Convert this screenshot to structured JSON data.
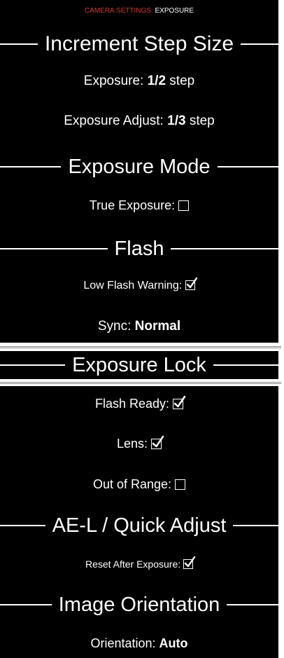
{
  "breadcrumb": {
    "section": "CAMERA SETTINGS:",
    "page": "EXPOSURE"
  },
  "colors": {
    "background": "#000000",
    "accent": "#d23a2e",
    "text": "#ffffff"
  },
  "sections": {
    "increment": {
      "title": "Increment Step Size",
      "exposure": {
        "label": "Exposure:",
        "value": "1/2",
        "unit": "step"
      },
      "exposure_adjust": {
        "label": "Exposure Adjust:",
        "value": "1/3",
        "unit": "step"
      }
    },
    "mode": {
      "title": "Exposure Mode",
      "true_exposure": {
        "label": "True Exposure:",
        "checked": false
      }
    },
    "flash": {
      "title": "Flash",
      "low_flash_warning": {
        "label": "Low Flash Warning:",
        "checked": true
      },
      "sync": {
        "label": "Sync:",
        "value": "Normal"
      }
    },
    "lock": {
      "title": "Exposure Lock",
      "flash_ready": {
        "label": "Flash Ready:",
        "checked": true
      },
      "lens": {
        "label": "Lens:",
        "checked": true
      },
      "out_of_range": {
        "label": "Out of Range:",
        "checked": false
      }
    },
    "ael": {
      "title": "AE-L / Quick Adjust",
      "reset_after_exposure": {
        "label": "Reset After Exposure:",
        "checked": true
      }
    },
    "orientation": {
      "title": "Image Orientation",
      "orientation": {
        "label": "Orientation:",
        "value": "Auto"
      }
    }
  }
}
